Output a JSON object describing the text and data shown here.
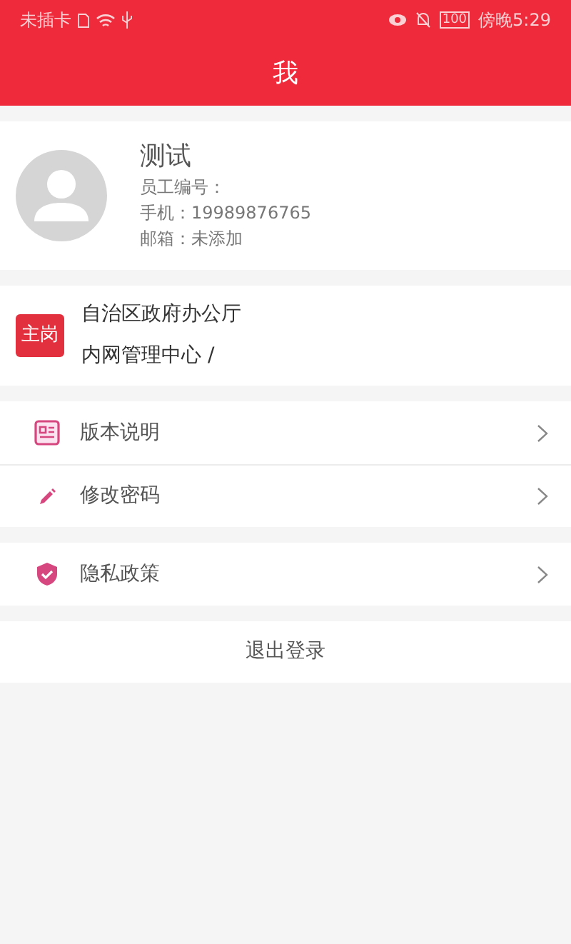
{
  "status_bar": {
    "carrier": "未插卡",
    "battery": "100",
    "time": "傍晚5:29"
  },
  "header": {
    "title": "我"
  },
  "profile": {
    "name": "测试",
    "lines": [
      "员工编号：",
      "手机：19989876765",
      "邮箱：未添加"
    ]
  },
  "position": {
    "badge": "主岗",
    "org": "自治区政府办公厅",
    "dept": "内网管理中心 /"
  },
  "menu_groups": [
    [
      {
        "kind": "news",
        "label": "版本说明"
      },
      {
        "kind": "pencil",
        "label": "修改密码"
      }
    ],
    [
      {
        "kind": "shield",
        "label": "隐私政策"
      }
    ]
  ],
  "logout": "退出登录"
}
